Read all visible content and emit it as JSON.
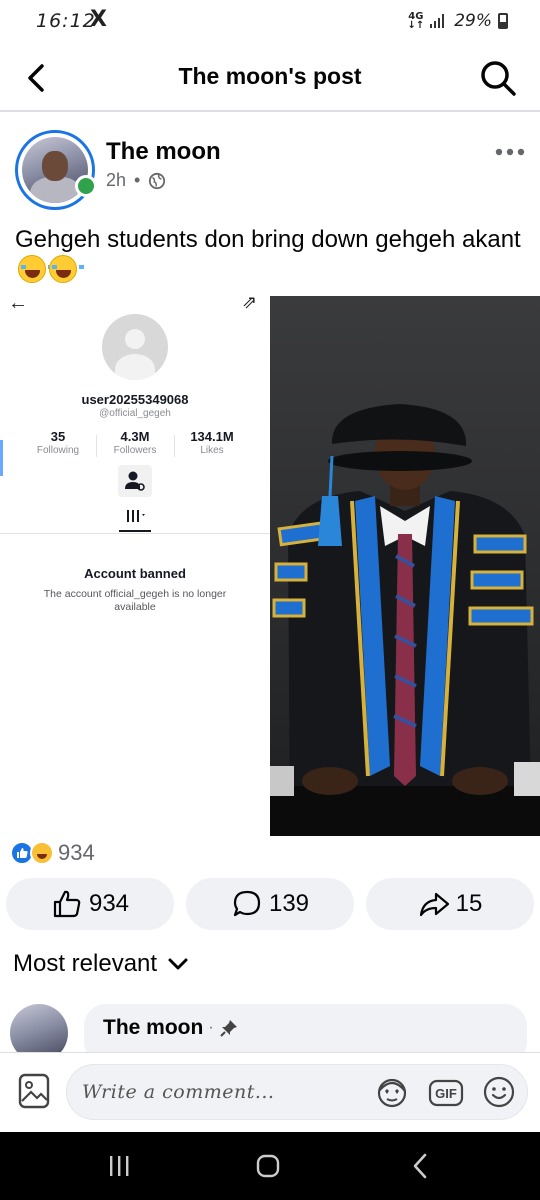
{
  "status_bar": {
    "time": "16:12",
    "x_logo": "X",
    "network": "4G",
    "battery": "29%"
  },
  "header": {
    "title": "The moon's post"
  },
  "post": {
    "author": "The moon",
    "time": "2h",
    "separator": "•",
    "audience_icon": "globe-icon",
    "text": "Gehgeh students don bring down gehgeh akant",
    "text_emoji": "laughing-crying-emoji",
    "left_image": {
      "username": "user20255349068",
      "handle": "@official_gegeh",
      "stats": [
        {
          "value": "35",
          "label": "Following"
        },
        {
          "value": "4.3M",
          "label": "Followers"
        },
        {
          "value": "134.1M",
          "label": "Likes"
        }
      ],
      "banned_title": "Account banned",
      "banned_message": "The account official_gegeh is no longer available"
    },
    "right_image": {
      "description_icon": "graduation-portrait"
    },
    "reaction_count": "934",
    "actions": {
      "like_count": "934",
      "comment_count": "139",
      "share_count": "15"
    }
  },
  "comments": {
    "sort_label": "Most relevant",
    "first": {
      "author": "The moon",
      "dot": "·"
    }
  },
  "composer": {
    "placeholder": "Write a comment...",
    "gif_label": "GIF"
  },
  "colors": {
    "accent": "#1b74e4",
    "online": "#31a24c",
    "button_bg": "#eff1f4"
  }
}
